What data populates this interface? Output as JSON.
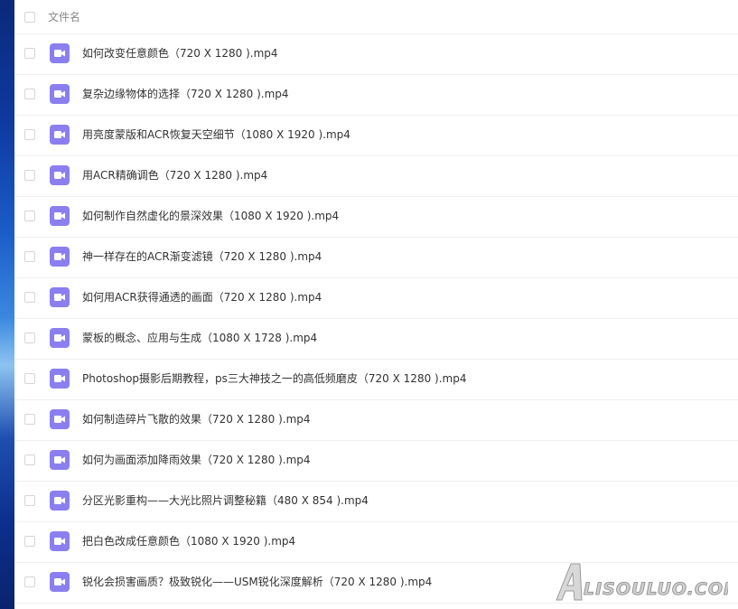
{
  "header": {
    "column_label": "文件名"
  },
  "files": [
    {
      "name": "如何改变任意颜色（720 X 1280 ).mp4",
      "icon": "video-icon"
    },
    {
      "name": "复杂边缘物体的选择（720 X 1280 ).mp4",
      "icon": "video-icon"
    },
    {
      "name": "用亮度蒙版和ACR恢复天空细节（1080 X 1920 ).mp4",
      "icon": "video-icon"
    },
    {
      "name": "用ACR精确调色（720 X 1280 ).mp4",
      "icon": "video-icon"
    },
    {
      "name": "如何制作自然虚化的景深效果（1080 X 1920 ).mp4",
      "icon": "video-icon"
    },
    {
      "name": "神一样存在的ACR渐变滤镜（720 X 1280 ).mp4",
      "icon": "video-icon"
    },
    {
      "name": "如何用ACR获得通透的画面（720 X 1280 ).mp4",
      "icon": "video-icon"
    },
    {
      "name": "蒙板的概念、应用与生成（1080 X 1728 ).mp4",
      "icon": "video-icon"
    },
    {
      "name": "Photoshop摄影后期教程，ps三大神技之一的高低频磨皮（720 X 1280 ).mp4",
      "icon": "video-icon"
    },
    {
      "name": "如何制造碎片飞散的效果（720 X 1280 ).mp4",
      "icon": "video-icon"
    },
    {
      "name": "如何为画面添加降雨效果（720 X 1280 ).mp4",
      "icon": "video-icon"
    },
    {
      "name": "分区光影重构——大光比照片调整秘籍（480 X 854 ).mp4",
      "icon": "video-icon"
    },
    {
      "name": "把白色改成任意颜色（1080 X 1920 ).mp4",
      "icon": "video-icon"
    },
    {
      "name": "锐化会损害画质？极致锐化——USM锐化深度解析（720 X 1280 ).mp4",
      "icon": "video-icon"
    }
  ],
  "watermark": {
    "text": "ALISOULUO.COM"
  },
  "colors": {
    "icon_bg": "#8b7ff0",
    "row_divider": "#f0f0f0",
    "text": "#333333",
    "header_text": "#888888"
  }
}
